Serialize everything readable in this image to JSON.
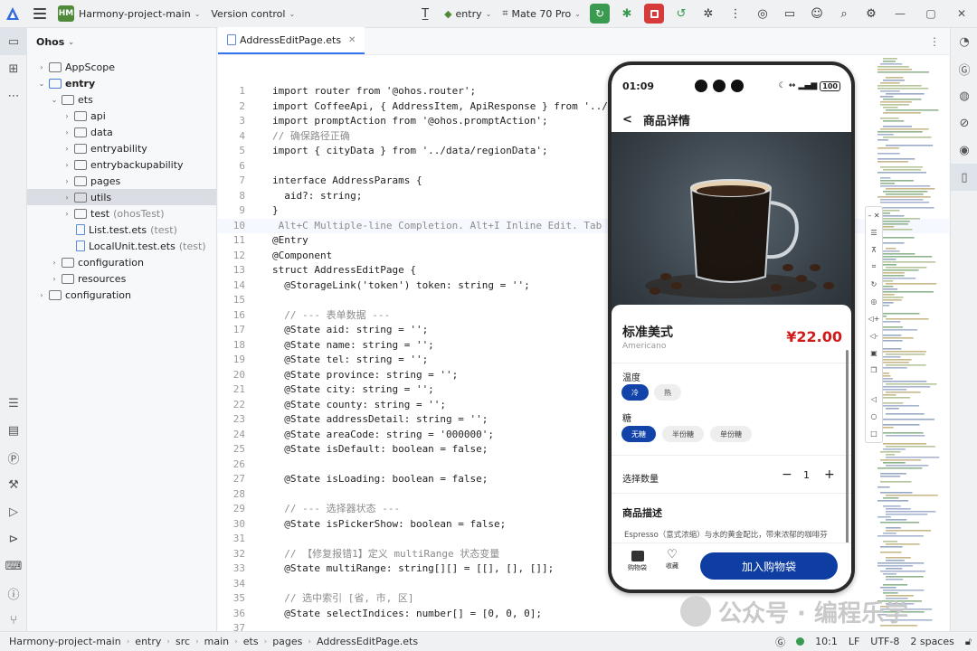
{
  "toolbar": {
    "project_badge": "HM",
    "project_name": "Harmony-project-main",
    "vcs_label": "Version control",
    "module": "entry",
    "device": "Mate 70 Pro"
  },
  "project_panel": {
    "title": "Ohos",
    "tree": [
      {
        "label": "AppScope",
        "depth": 1,
        "arrow": "›",
        "kind": "folder"
      },
      {
        "label": "entry",
        "depth": 1,
        "arrow": "⌄",
        "kind": "folder-mod",
        "bold": true
      },
      {
        "label": "ets",
        "depth": 2,
        "arrow": "⌄",
        "kind": "folder"
      },
      {
        "label": "api",
        "depth": 3,
        "arrow": "›",
        "kind": "folder"
      },
      {
        "label": "data",
        "depth": 3,
        "arrow": "›",
        "kind": "folder"
      },
      {
        "label": "entryability",
        "depth": 3,
        "arrow": "›",
        "kind": "folder"
      },
      {
        "label": "entrybackupability",
        "depth": 3,
        "arrow": "›",
        "kind": "folder"
      },
      {
        "label": "pages",
        "depth": 3,
        "arrow": "›",
        "kind": "folder"
      },
      {
        "label": "utils",
        "depth": 3,
        "arrow": "›",
        "kind": "folder",
        "selected": true
      },
      {
        "label": "test",
        "suffix": "(ohosTest)",
        "depth": 3,
        "arrow": "›",
        "kind": "folder"
      },
      {
        "label": "List.test.ets",
        "suffix": "(test)",
        "depth": 3,
        "arrow": "",
        "kind": "file"
      },
      {
        "label": "LocalUnit.test.ets",
        "suffix": "(test)",
        "depth": 3,
        "arrow": "",
        "kind": "file"
      },
      {
        "label": "configuration",
        "depth": 2,
        "arrow": "›",
        "kind": "folder"
      },
      {
        "label": "resources",
        "depth": 2,
        "arrow": "›",
        "kind": "folder"
      },
      {
        "label": "configuration",
        "depth": 1,
        "arrow": "›",
        "kind": "folder"
      }
    ]
  },
  "editor": {
    "tab_label": "AddressEditPage.ets",
    "lines": [
      {
        "n": "1",
        "t": "import router from '@ohos.router';"
      },
      {
        "n": "2",
        "t": "import CoffeeApi, { AddressItem, ApiResponse } from '../api/Co"
      },
      {
        "n": "3",
        "t": "import promptAction from '@ohos.promptAction';"
      },
      {
        "n": "4",
        "t": "// 确保路径正确"
      },
      {
        "n": "5",
        "t": "import { cityData } from '../data/regionData';"
      },
      {
        "n": "6",
        "t": ""
      },
      {
        "n": "7",
        "t": "interface AddressParams {"
      },
      {
        "n": "8",
        "t": "  aid?: string;"
      },
      {
        "n": "9",
        "t": "}"
      },
      {
        "n": "10",
        "t": " Alt+C Multiple-line Completion. Alt+I Inline Edit. Tab Accept"
      },
      {
        "n": "11",
        "t": "@Entry"
      },
      {
        "n": "12",
        "t": "@Component"
      },
      {
        "n": "13",
        "t": "struct AddressEditPage {"
      },
      {
        "n": "14",
        "t": "  @StorageLink('token') token: string = '';"
      },
      {
        "n": "15",
        "t": ""
      },
      {
        "n": "16",
        "t": "  // --- 表单数据 ---"
      },
      {
        "n": "17",
        "t": "  @State aid: string = '';"
      },
      {
        "n": "18",
        "t": "  @State name: string = '';"
      },
      {
        "n": "19",
        "t": "  @State tel: string = '';"
      },
      {
        "n": "20",
        "t": "  @State province: string = '';"
      },
      {
        "n": "21",
        "t": "  @State city: string = '';"
      },
      {
        "n": "22",
        "t": "  @State county: string = '';"
      },
      {
        "n": "23",
        "t": "  @State addressDetail: string = '';"
      },
      {
        "n": "24",
        "t": "  @State areaCode: string = '000000';"
      },
      {
        "n": "25",
        "t": "  @State isDefault: boolean = false;"
      },
      {
        "n": "26",
        "t": ""
      },
      {
        "n": "27",
        "t": "  @State isLoading: boolean = false;"
      },
      {
        "n": "28",
        "t": ""
      },
      {
        "n": "29",
        "t": "  // --- 选择器状态 ---"
      },
      {
        "n": "30",
        "t": "  @State isPickerShow: boolean = false;"
      },
      {
        "n": "31",
        "t": ""
      },
      {
        "n": "32",
        "t": "  // 【修复报错1】定义 multiRange 状态变量"
      },
      {
        "n": "33",
        "t": "  @State multiRange: string[][] = [[], [], []];"
      },
      {
        "n": "34",
        "t": ""
      },
      {
        "n": "35",
        "t": "  // 选中索引 [省, 市, 区]"
      },
      {
        "n": "36",
        "t": "  @State selectIndices: number[] = [0, 0, 0];"
      },
      {
        "n": "37",
        "t": ""
      }
    ]
  },
  "phone": {
    "time": "01:09",
    "battery": "100",
    "page_title": "商品详情",
    "product_name": "标准美式",
    "product_en": "Americano",
    "price": "¥22.00",
    "temp_label": "温度",
    "temp_options": [
      "冷",
      "热"
    ],
    "sugar_label": "糖",
    "sugar_options": [
      "无糖",
      "半份糖",
      "单份糖"
    ],
    "qty_label": "选择数量",
    "qty": "1",
    "desc_title": "商品描述",
    "desc_text": "Espresso（意式浓缩）与水的黄金配比，带来浓郁的咖啡芬芳，成为脑海中挥之不去的绝妙体验。",
    "tab_cart": "购物袋",
    "tab_fav": "收藏",
    "buy_label": "加入购物袋"
  },
  "statusbar": {
    "crumbs": [
      "Harmony-project-main",
      "entry",
      "src",
      "main",
      "ets",
      "pages",
      "AddressEditPage.ets"
    ],
    "cursor": "10:1",
    "eol": "LF",
    "encoding": "UTF-8",
    "indent": "2 spaces"
  },
  "watermark": "公众号 · 编程乐学",
  "colors": {
    "accent": "#3574f0",
    "run": "#3a9a50",
    "stop": "#d63a3a",
    "price": "#d11a1a",
    "primary_btn": "#0f3ea3"
  }
}
